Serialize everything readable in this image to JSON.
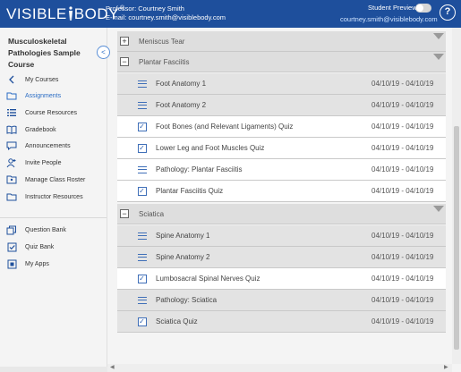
{
  "header": {
    "logo": "VISIBLE BODY",
    "logo_left": "VISIBLE",
    "logo_right": "BODY",
    "logo_mark": "®",
    "professor": "Professor: Courtney Smith",
    "email_line": "E-mail: courtney.smith@visiblebody.com",
    "student_preview": "Student Preview",
    "email": "courtney.smith@visiblebody.com",
    "help": "?"
  },
  "sidebar": {
    "course_title": "Musculoskeletal Pathologies Sample Course",
    "collapse": "<",
    "items": [
      {
        "label": "My Courses",
        "icon": "chevron-left-icon"
      },
      {
        "label": "Assignments",
        "icon": "folder-icon"
      },
      {
        "label": "Course Resources",
        "icon": "list-icon"
      },
      {
        "label": "Gradebook",
        "icon": "book-icon"
      },
      {
        "label": "Announcements",
        "icon": "chat-icon"
      },
      {
        "label": "Invite People",
        "icon": "add-person-icon"
      },
      {
        "label": "Manage Class Roster",
        "icon": "roster-icon"
      },
      {
        "label": "Instructor Resources",
        "icon": "folder-icon"
      }
    ],
    "bottom_items": [
      {
        "label": "Question Bank",
        "icon": "copy-icon"
      },
      {
        "label": "Quiz Bank",
        "icon": "checkbox-icon"
      },
      {
        "label": "My Apps",
        "icon": "apps-icon"
      }
    ]
  },
  "sections": [
    {
      "name": "Meniscus Tear",
      "toggle": "+"
    },
    {
      "name": "Plantar Fasciitis",
      "toggle": "−"
    },
    {
      "name": "Sciatica",
      "toggle": "−"
    }
  ],
  "plantar_items": [
    {
      "label": "Foot Anatomy 1",
      "dates": "04/10/19 - 04/10/19",
      "icon": "list-icon"
    },
    {
      "label": "Foot Anatomy 2",
      "dates": "04/10/19 - 04/10/19",
      "icon": "list-icon"
    },
    {
      "label": "Foot Bones (and Relevant Ligaments) Quiz",
      "dates": "04/10/19 - 04/10/19",
      "icon": "checkbox-icon"
    },
    {
      "label": "Lower Leg and Foot Muscles Quiz",
      "dates": "04/10/19 - 04/10/19",
      "icon": "checkbox-icon"
    },
    {
      "label": "Pathology: Plantar Fasciitis",
      "dates": "04/10/19 - 04/10/19",
      "icon": "list-icon"
    },
    {
      "label": "Plantar Fasciitis Quiz",
      "dates": "04/10/19 - 04/10/19",
      "icon": "checkbox-icon"
    }
  ],
  "sciatica_items": [
    {
      "label": "Spine Anatomy 1",
      "dates": "04/10/19 - 04/10/19",
      "icon": "list-icon"
    },
    {
      "label": "Spine Anatomy 2",
      "dates": "04/10/19 - 04/10/19",
      "icon": "list-icon"
    },
    {
      "label": "Lumbosacral Spinal Nerves Quiz",
      "dates": "04/10/19 - 04/10/19",
      "icon": "checkbox-icon"
    },
    {
      "label": "Pathology: Sciatica",
      "dates": "04/10/19 - 04/10/19",
      "icon": "list-icon"
    },
    {
      "label": "Sciatica Quiz",
      "dates": "04/10/19 - 04/10/19",
      "icon": "checkbox-icon"
    }
  ],
  "colors": {
    "header": "#1e4f9c",
    "accent": "#2a6cc4"
  }
}
